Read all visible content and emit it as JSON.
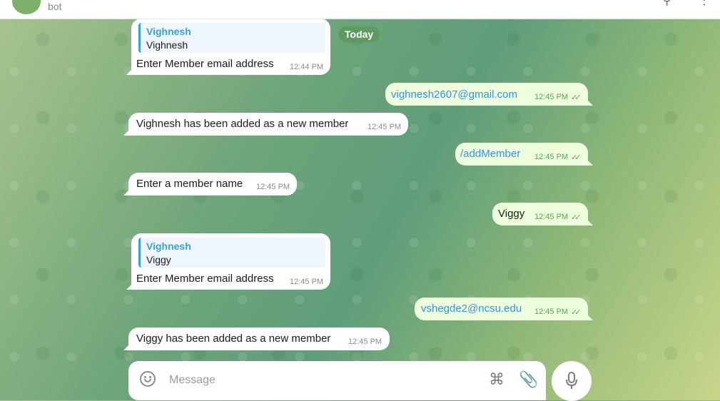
{
  "header": {
    "subtitle": "bot"
  },
  "date_chip": "Today",
  "messages": [
    {
      "dir": "in",
      "quote_name": "Vighnesh",
      "quote_text": "Vighnesh",
      "text": "Enter Member email address",
      "time": "12:44 PM"
    },
    {
      "dir": "out",
      "text": "vighnesh2607@gmail.com",
      "time": "12:45 PM",
      "link": true
    },
    {
      "dir": "in",
      "text": "Vighnesh has been added as a new member",
      "time": "12:45 PM"
    },
    {
      "dir": "out",
      "text": "/addMember",
      "time": "12:45 PM",
      "link": true
    },
    {
      "dir": "in",
      "text": "Enter a member name",
      "time": "12:45 PM"
    },
    {
      "dir": "out",
      "text": "Viggy",
      "time": "12:45 PM"
    },
    {
      "dir": "in",
      "quote_name": "Vighnesh",
      "quote_text": "Viggy",
      "text": "Enter Member email address",
      "time": "12:45 PM"
    },
    {
      "dir": "out",
      "text": "vshegde2@ncsu.edu",
      "time": "12:45 PM",
      "link": true
    },
    {
      "dir": "in",
      "text": "Viggy has been added as a new member",
      "time": "12:45 PM"
    }
  ],
  "composer": {
    "placeholder": "Message"
  },
  "icons": {
    "header": [
      "search-icon",
      "more-vertical-icon"
    ],
    "composer": [
      "emoji-icon",
      "command-icon",
      "paperclip-icon",
      "microphone-icon"
    ]
  },
  "colors": {
    "outgoing_bubble": "#eeffde",
    "incoming_bubble": "#ffffff",
    "link": "#3390ec",
    "accent_green": "#5c9a62"
  }
}
